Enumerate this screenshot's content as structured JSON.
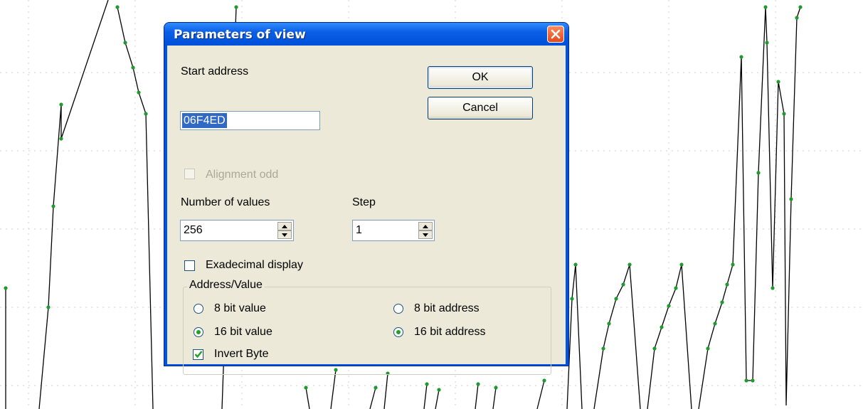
{
  "dialog": {
    "title": "Parameters of view",
    "start_address_label": "Start address",
    "start_address_value": "06F4ED",
    "ok_label": "OK",
    "cancel_label": "Cancel",
    "alignment_label": "Alignment odd",
    "number_of_values_label": "Number of values",
    "number_of_values_value": "256",
    "step_label": "Step",
    "step_value": "1",
    "hex_display_label": "Exadecimal display",
    "group_title": "Address/Value",
    "radio_8bit_value": "8 bit value",
    "radio_16bit_value": "16 bit value",
    "radio_8bit_address": "8 bit address",
    "radio_16bit_address": "16 bit address",
    "invert_byte_label": "Invert Byte",
    "state": {
      "alignment_odd": false,
      "alignment_enabled": false,
      "hex_display": false,
      "value_width": "16 bit value",
      "address_width": "16 bit address",
      "invert_byte": true
    }
  },
  "colors": {
    "title_blue": "#0053e3",
    "close_red": "#e2491c",
    "dialog_face": "#ece9d8",
    "selection": "#316ac5",
    "plot_line": "#000000",
    "plot_points": "#1f9a2e",
    "grid": "#d0d0d0"
  },
  "icons": {
    "close": "close-x-icon",
    "spin_up": "triangle-up-icon",
    "spin_down": "triangle-down-icon",
    "check": "check-mark-icon"
  }
}
